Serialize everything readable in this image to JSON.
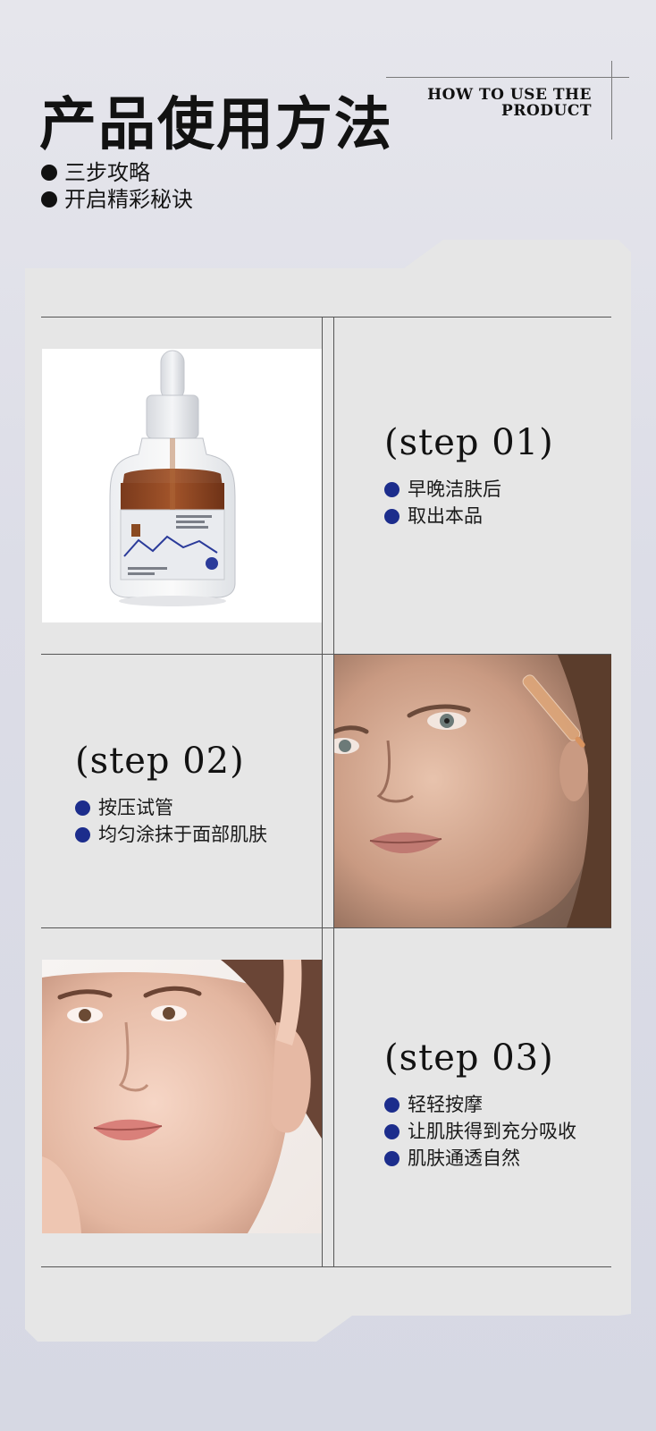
{
  "header": {
    "title": "产品使用方法",
    "bullets": [
      "三步攻略",
      "开启精彩秘诀"
    ],
    "en_title_line1": "HOW TO USE THE",
    "en_title_line2": "PRODUCT"
  },
  "steps": [
    {
      "heading": "(step 01)",
      "items": [
        "早晚洁肤后",
        "取出本品"
      ]
    },
    {
      "heading": "(step 02)",
      "items": [
        "按压试管",
        "均匀涂抹于面部肌肤"
      ]
    },
    {
      "heading": "(step 03)",
      "items": [
        "轻轻按摩",
        "让肌肤得到充分吸收",
        "肌肤通透自然"
      ]
    }
  ],
  "images": {
    "bottle": "serum-bottle-photo",
    "face_dropper": "model-face-with-dropper-photo",
    "face_hand": "model-face-with-hand-photo"
  },
  "colors": {
    "accent_dot": "#1c2d8c",
    "panel": "#e6e6e6"
  }
}
